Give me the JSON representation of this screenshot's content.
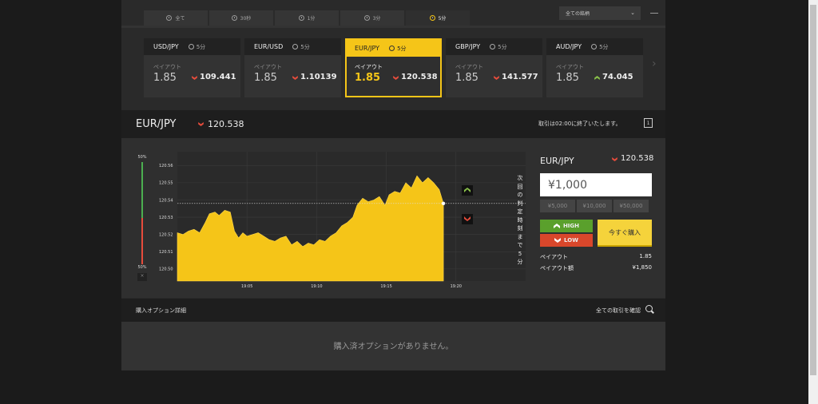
{
  "tabs": [
    {
      "label": "全て"
    },
    {
      "label": "30秒"
    },
    {
      "label": "1分"
    },
    {
      "label": "3分"
    },
    {
      "label": "5分",
      "active": true
    }
  ],
  "account": {
    "label": "全ての銘柄"
  },
  "cards": [
    {
      "pair": "USD/JPY",
      "tf": "5分",
      "payout_label": "ペイアウト",
      "payout": "1.85",
      "rate": "109.441",
      "dir": "down"
    },
    {
      "pair": "EUR/USD",
      "tf": "5分",
      "payout_label": "ペイアウト",
      "payout": "1.85",
      "rate": "1.10139",
      "dir": "down"
    },
    {
      "pair": "EUR/JPY",
      "tf": "5分",
      "payout_label": "ペイアウト",
      "payout": "1.85",
      "rate": "120.538",
      "dir": "down",
      "active": true
    },
    {
      "pair": "GBP/JPY",
      "tf": "5分",
      "payout_label": "ペイアウト",
      "payout": "1.85",
      "rate": "141.577",
      "dir": "down"
    },
    {
      "pair": "AUD/JPY",
      "tf": "5分",
      "payout_label": "ペイアウト",
      "payout": "1.85",
      "rate": "74.045",
      "dir": "up"
    }
  ],
  "pair_header": {
    "name": "EUR/JPY",
    "rate": "120.538",
    "notice": "取引は02:00に終了いたします。",
    "cal": "1"
  },
  "gauge": {
    "top": "50%",
    "bottom": "50%",
    "close": "×",
    "high_share": 0.5
  },
  "next_judge": "次回の判定時刻まで5分",
  "colors": {
    "accent": "#f5c518",
    "up": "#5aa02c",
    "down": "#d9472b"
  },
  "chart_data": {
    "type": "area",
    "y_ticks": [
      "120.56",
      "120.55",
      "120.54",
      "120.53",
      "120.52",
      "120.51",
      "120.50"
    ],
    "ylim": [
      120.493,
      120.568
    ],
    "x_ticks": [
      "19:05",
      "19:10",
      "19:15",
      "19:20"
    ],
    "x_tick_values": [
      5,
      10,
      15,
      20
    ],
    "xlim": [
      0,
      25
    ],
    "current_rate": 120.538,
    "current_x": 19.1,
    "values": [
      [
        0,
        120.521
      ],
      [
        0.4,
        120.52
      ],
      [
        0.8,
        120.522
      ],
      [
        1.2,
        120.523
      ],
      [
        1.6,
        120.521
      ],
      [
        2,
        120.527
      ],
      [
        2.3,
        120.532
      ],
      [
        2.7,
        120.533
      ],
      [
        3,
        120.531
      ],
      [
        3.4,
        120.534
      ],
      [
        3.8,
        120.533
      ],
      [
        4.1,
        120.522
      ],
      [
        4.4,
        120.518
      ],
      [
        4.7,
        120.521
      ],
      [
        5,
        120.519
      ],
      [
        5.4,
        120.52
      ],
      [
        5.8,
        120.521
      ],
      [
        6.2,
        120.519
      ],
      [
        6.6,
        120.517
      ],
      [
        7,
        120.516
      ],
      [
        7.4,
        120.518
      ],
      [
        7.8,
        120.519
      ],
      [
        8.2,
        120.514
      ],
      [
        8.6,
        120.516
      ],
      [
        9,
        120.513
      ],
      [
        9.4,
        120.515
      ],
      [
        9.8,
        120.514
      ],
      [
        10.2,
        120.517
      ],
      [
        10.6,
        120.516
      ],
      [
        11,
        120.519
      ],
      [
        11.4,
        120.521
      ],
      [
        11.8,
        120.525
      ],
      [
        12.2,
        120.527
      ],
      [
        12.6,
        120.53
      ],
      [
        12.9,
        120.537
      ],
      [
        13.3,
        120.541
      ],
      [
        13.7,
        120.539
      ],
      [
        14.1,
        120.54
      ],
      [
        14.5,
        120.542
      ],
      [
        14.9,
        120.537
      ],
      [
        15.2,
        120.543
      ],
      [
        15.6,
        120.545
      ],
      [
        16,
        120.544
      ],
      [
        16.4,
        120.55
      ],
      [
        16.8,
        120.547
      ],
      [
        17.2,
        120.554
      ],
      [
        17.6,
        120.55
      ],
      [
        18,
        120.553
      ],
      [
        18.4,
        120.55
      ],
      [
        18.8,
        120.546
      ],
      [
        19.1,
        120.538
      ]
    ]
  },
  "trade": {
    "pair": "EUR/JPY",
    "rate": "120.538",
    "amount": "¥1,000",
    "presets": [
      "¥5,000",
      "¥10,000",
      "¥50,000"
    ],
    "high": "HIGH",
    "low": "LOW",
    "buy": "今すぐ購入",
    "payout_label": "ペイアウト",
    "payout": "1.85",
    "payout_amount_label": "ペイアウト額",
    "payout_amount": "¥1,850"
  },
  "options": {
    "title": "購入オプション詳細",
    "all": "全ての取引を確認",
    "empty": "購入済オプションがありません。"
  }
}
